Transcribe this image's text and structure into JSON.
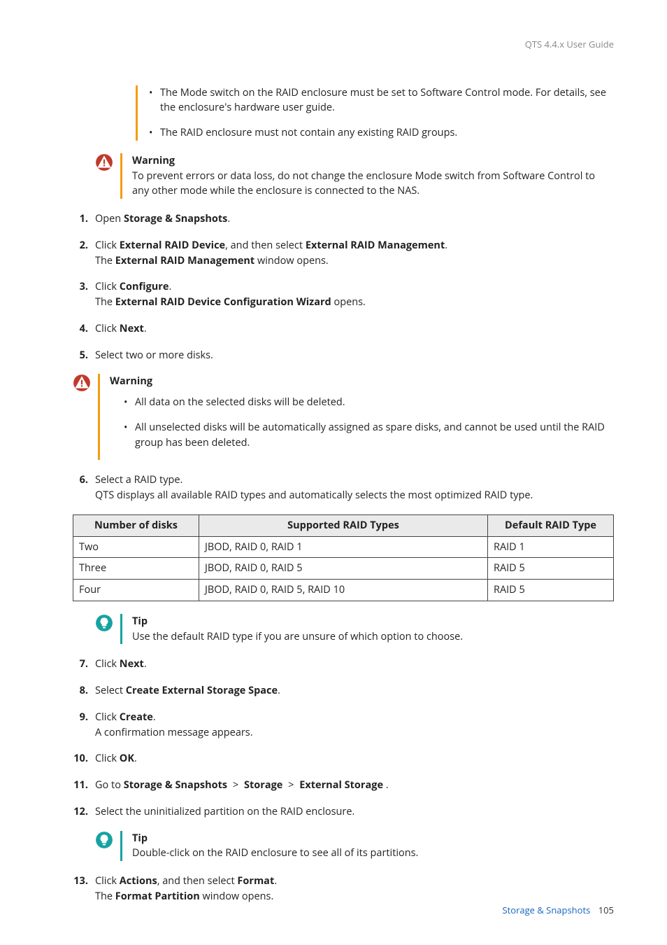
{
  "header": {
    "guide_title": "QTS 4.4.x User Guide"
  },
  "intro_bullets": [
    "The Mode switch on the RAID enclosure must be set to Software Control mode. For details, see the enclosure's hardware user guide.",
    "The RAID enclosure must not contain any existing RAID groups."
  ],
  "warnings": {
    "label": "Warning",
    "w1_text": "To prevent errors or data loss, do not change the enclosure Mode switch from Software Control to any other mode while the enclosure is connected to the NAS.",
    "w2_bullets": [
      "All data on the selected disks will be deleted.",
      "All unselected disks will be automatically assigned as spare disks, and cannot be used until the RAID group has been deleted."
    ]
  },
  "tips": {
    "label": "Tip",
    "t1_text": "Use the default RAID type if you are unsure of which option to choose.",
    "t2_text": "Double-click on the RAID enclosure to see all of its partitions."
  },
  "steps": {
    "s1": {
      "pre": "Open ",
      "b1": "Storage & Snapshots",
      "post": "."
    },
    "s2": {
      "line1_pre": "Click ",
      "line1_b1": "External RAID Device",
      "line1_mid": ", and then select ",
      "line1_b2": "External RAID Management",
      "line1_post": ".",
      "line2_pre": "The ",
      "line2_b1": "External RAID Management",
      "line2_post": " window opens."
    },
    "s3": {
      "line1_pre": "Click ",
      "line1_b1": "Configure",
      "line1_post": ".",
      "line2_pre": "The ",
      "line2_b1": "External RAID Device Configuration Wizard",
      "line2_post": " opens."
    },
    "s4": {
      "pre": "Click ",
      "b1": "Next",
      "post": "."
    },
    "s5": {
      "text": "Select two or more disks."
    },
    "s6": {
      "line1": "Select a RAID type.",
      "line2": "QTS displays all available RAID types and automatically selects the most optimized RAID type."
    },
    "s7": {
      "pre": "Click ",
      "b1": "Next",
      "post": "."
    },
    "s8": {
      "pre": "Select ",
      "b1": "Create External Storage Space",
      "post": "."
    },
    "s9": {
      "line1_pre": "Click ",
      "line1_b1": "Create",
      "line1_post": ".",
      "line2": "A confirmation message appears."
    },
    "s10": {
      "pre": "Click ",
      "b1": "OK",
      "post": "."
    },
    "s11": {
      "pre": "Go to ",
      "b1": "Storage & Snapshots",
      "sep": ">",
      "b2": "Storage",
      "b3": "External Storage",
      "post": " ."
    },
    "s12": {
      "text": "Select the uninitialized partition on the RAID enclosure."
    },
    "s13": {
      "line1_pre": "Click ",
      "line1_b1": "Actions",
      "line1_mid": ", and then select ",
      "line1_b2": "Format",
      "line1_post": ".",
      "line2_pre": "The ",
      "line2_b1": "Format Partition",
      "line2_post": " window opens."
    }
  },
  "table": {
    "headers": {
      "c1": "Number of disks",
      "c2": "Supported RAID Types",
      "c3": "Default RAID Type"
    },
    "rows": [
      {
        "c1": "Two",
        "c2": "JBOD, RAID 0, RAID 1",
        "c3": "RAID 1"
      },
      {
        "c1": "Three",
        "c2": "JBOD, RAID 0, RAID 5",
        "c3": "RAID 5"
      },
      {
        "c1": "Four",
        "c2": "JBOD, RAID 0, RAID 5, RAID 10",
        "c3": "RAID 5"
      }
    ]
  },
  "footer": {
    "section": "Storage & Snapshots",
    "page": "105"
  },
  "icons": {
    "warning_color": "#c0392b",
    "tip_color": "#17a2a2"
  }
}
